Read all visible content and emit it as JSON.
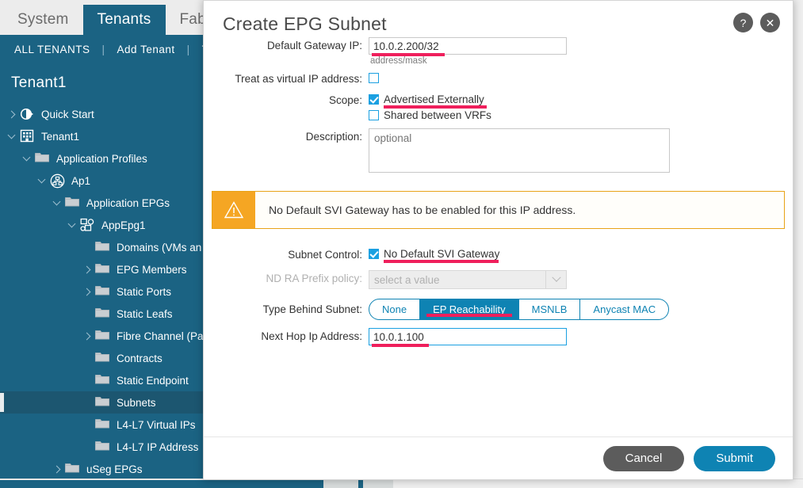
{
  "app": {
    "nav_tabs": [
      {
        "label": "System",
        "active": false
      },
      {
        "label": "Tenants",
        "active": true
      },
      {
        "label": "Fabric",
        "active": false
      }
    ],
    "subnav": [
      {
        "label": "ALL TENANTS"
      },
      {
        "label": "Add Tenant"
      },
      {
        "label": "T"
      }
    ],
    "subnav_separator": "|",
    "tenant_title": "Tenant1",
    "tree": [
      {
        "label": "Quick Start",
        "indent": 0,
        "twisty": "right",
        "icon": "quick-start-icon",
        "selected": false
      },
      {
        "label": "Tenant1",
        "indent": 0,
        "twisty": "down",
        "icon": "tenant-building-icon",
        "selected": false
      },
      {
        "label": "Application Profiles",
        "indent": 1,
        "twisty": "down",
        "icon": "folder-icon",
        "selected": false
      },
      {
        "label": "Ap1",
        "indent": 2,
        "twisty": "down",
        "icon": "app-profile-icon",
        "selected": false
      },
      {
        "label": "Application EPGs",
        "indent": 3,
        "twisty": "down",
        "icon": "folder-icon",
        "selected": false
      },
      {
        "label": "AppEpg1",
        "indent": 4,
        "twisty": "down",
        "icon": "epg-icon",
        "selected": false
      },
      {
        "label": "Domains (VMs an",
        "indent": 5,
        "twisty": "none",
        "icon": "folder-icon",
        "selected": false
      },
      {
        "label": "EPG Members",
        "indent": 5,
        "twisty": "right",
        "icon": "folder-icon",
        "selected": false
      },
      {
        "label": "Static Ports",
        "indent": 5,
        "twisty": "right",
        "icon": "folder-icon",
        "selected": false
      },
      {
        "label": "Static Leafs",
        "indent": 5,
        "twisty": "none",
        "icon": "folder-icon",
        "selected": false
      },
      {
        "label": "Fibre Channel (Pa",
        "indent": 5,
        "twisty": "right",
        "icon": "folder-icon",
        "selected": false
      },
      {
        "label": "Contracts",
        "indent": 5,
        "twisty": "none",
        "icon": "folder-icon",
        "selected": false
      },
      {
        "label": "Static Endpoint",
        "indent": 5,
        "twisty": "none",
        "icon": "folder-icon",
        "selected": false
      },
      {
        "label": "Subnets",
        "indent": 5,
        "twisty": "none",
        "icon": "folder-icon",
        "selected": true
      },
      {
        "label": "L4-L7 Virtual IPs",
        "indent": 5,
        "twisty": "none",
        "icon": "folder-icon",
        "selected": false
      },
      {
        "label": "L4-L7 IP Address",
        "indent": 5,
        "twisty": "none",
        "icon": "folder-icon",
        "selected": false
      },
      {
        "label": "uSeg EPGs",
        "indent": 3,
        "twisty": "right",
        "icon": "folder-icon",
        "selected": false
      }
    ]
  },
  "dialog": {
    "title": "Create EPG Subnet",
    "help_icon": "?",
    "close_icon": "✕",
    "default_gateway": {
      "label": "Default Gateway IP:",
      "value": "10.0.2.200/32",
      "hint": "address/mask"
    },
    "treat_as_virtual": {
      "label": "Treat as virtual IP address:",
      "checked": false
    },
    "scope": {
      "label": "Scope:",
      "options": [
        {
          "label": "Advertised Externally",
          "checked": true,
          "highlighted": true
        },
        {
          "label": "Shared between VRFs",
          "checked": false,
          "highlighted": false
        }
      ]
    },
    "description": {
      "label": "Description:",
      "placeholder": "optional",
      "value": ""
    },
    "warning": {
      "icon": "warning-triangle-icon",
      "text": "No Default SVI Gateway has to be enabled for this IP address.",
      "accent_color": "#f5a623"
    },
    "subnet_control": {
      "label": "Subnet Control:",
      "options": [
        {
          "label": "No Default SVI Gateway",
          "checked": true,
          "highlighted": true
        }
      ]
    },
    "nd_ra_prefix_policy": {
      "label": "ND RA Prefix policy:",
      "placeholder": "select a value",
      "disabled": true
    },
    "type_behind_subnet": {
      "label": "Type Behind Subnet:",
      "options": [
        {
          "label": "None",
          "active": false
        },
        {
          "label": "EP Reachability",
          "active": true
        },
        {
          "label": "MSNLB",
          "active": false
        },
        {
          "label": "Anycast MAC",
          "active": false
        }
      ]
    },
    "next_hop": {
      "label": "Next Hop Ip Address:",
      "value": "10.0.1.100",
      "highlighted": true
    },
    "buttons": {
      "cancel": "Cancel",
      "submit": "Submit"
    }
  },
  "colors": {
    "brand_teal": "#1b6383",
    "accent_blue": "#0e83b3",
    "highlight_pink": "#ef1f5c",
    "warning_orange": "#f5a623",
    "checkbox_blue": "#1ba0e1"
  }
}
